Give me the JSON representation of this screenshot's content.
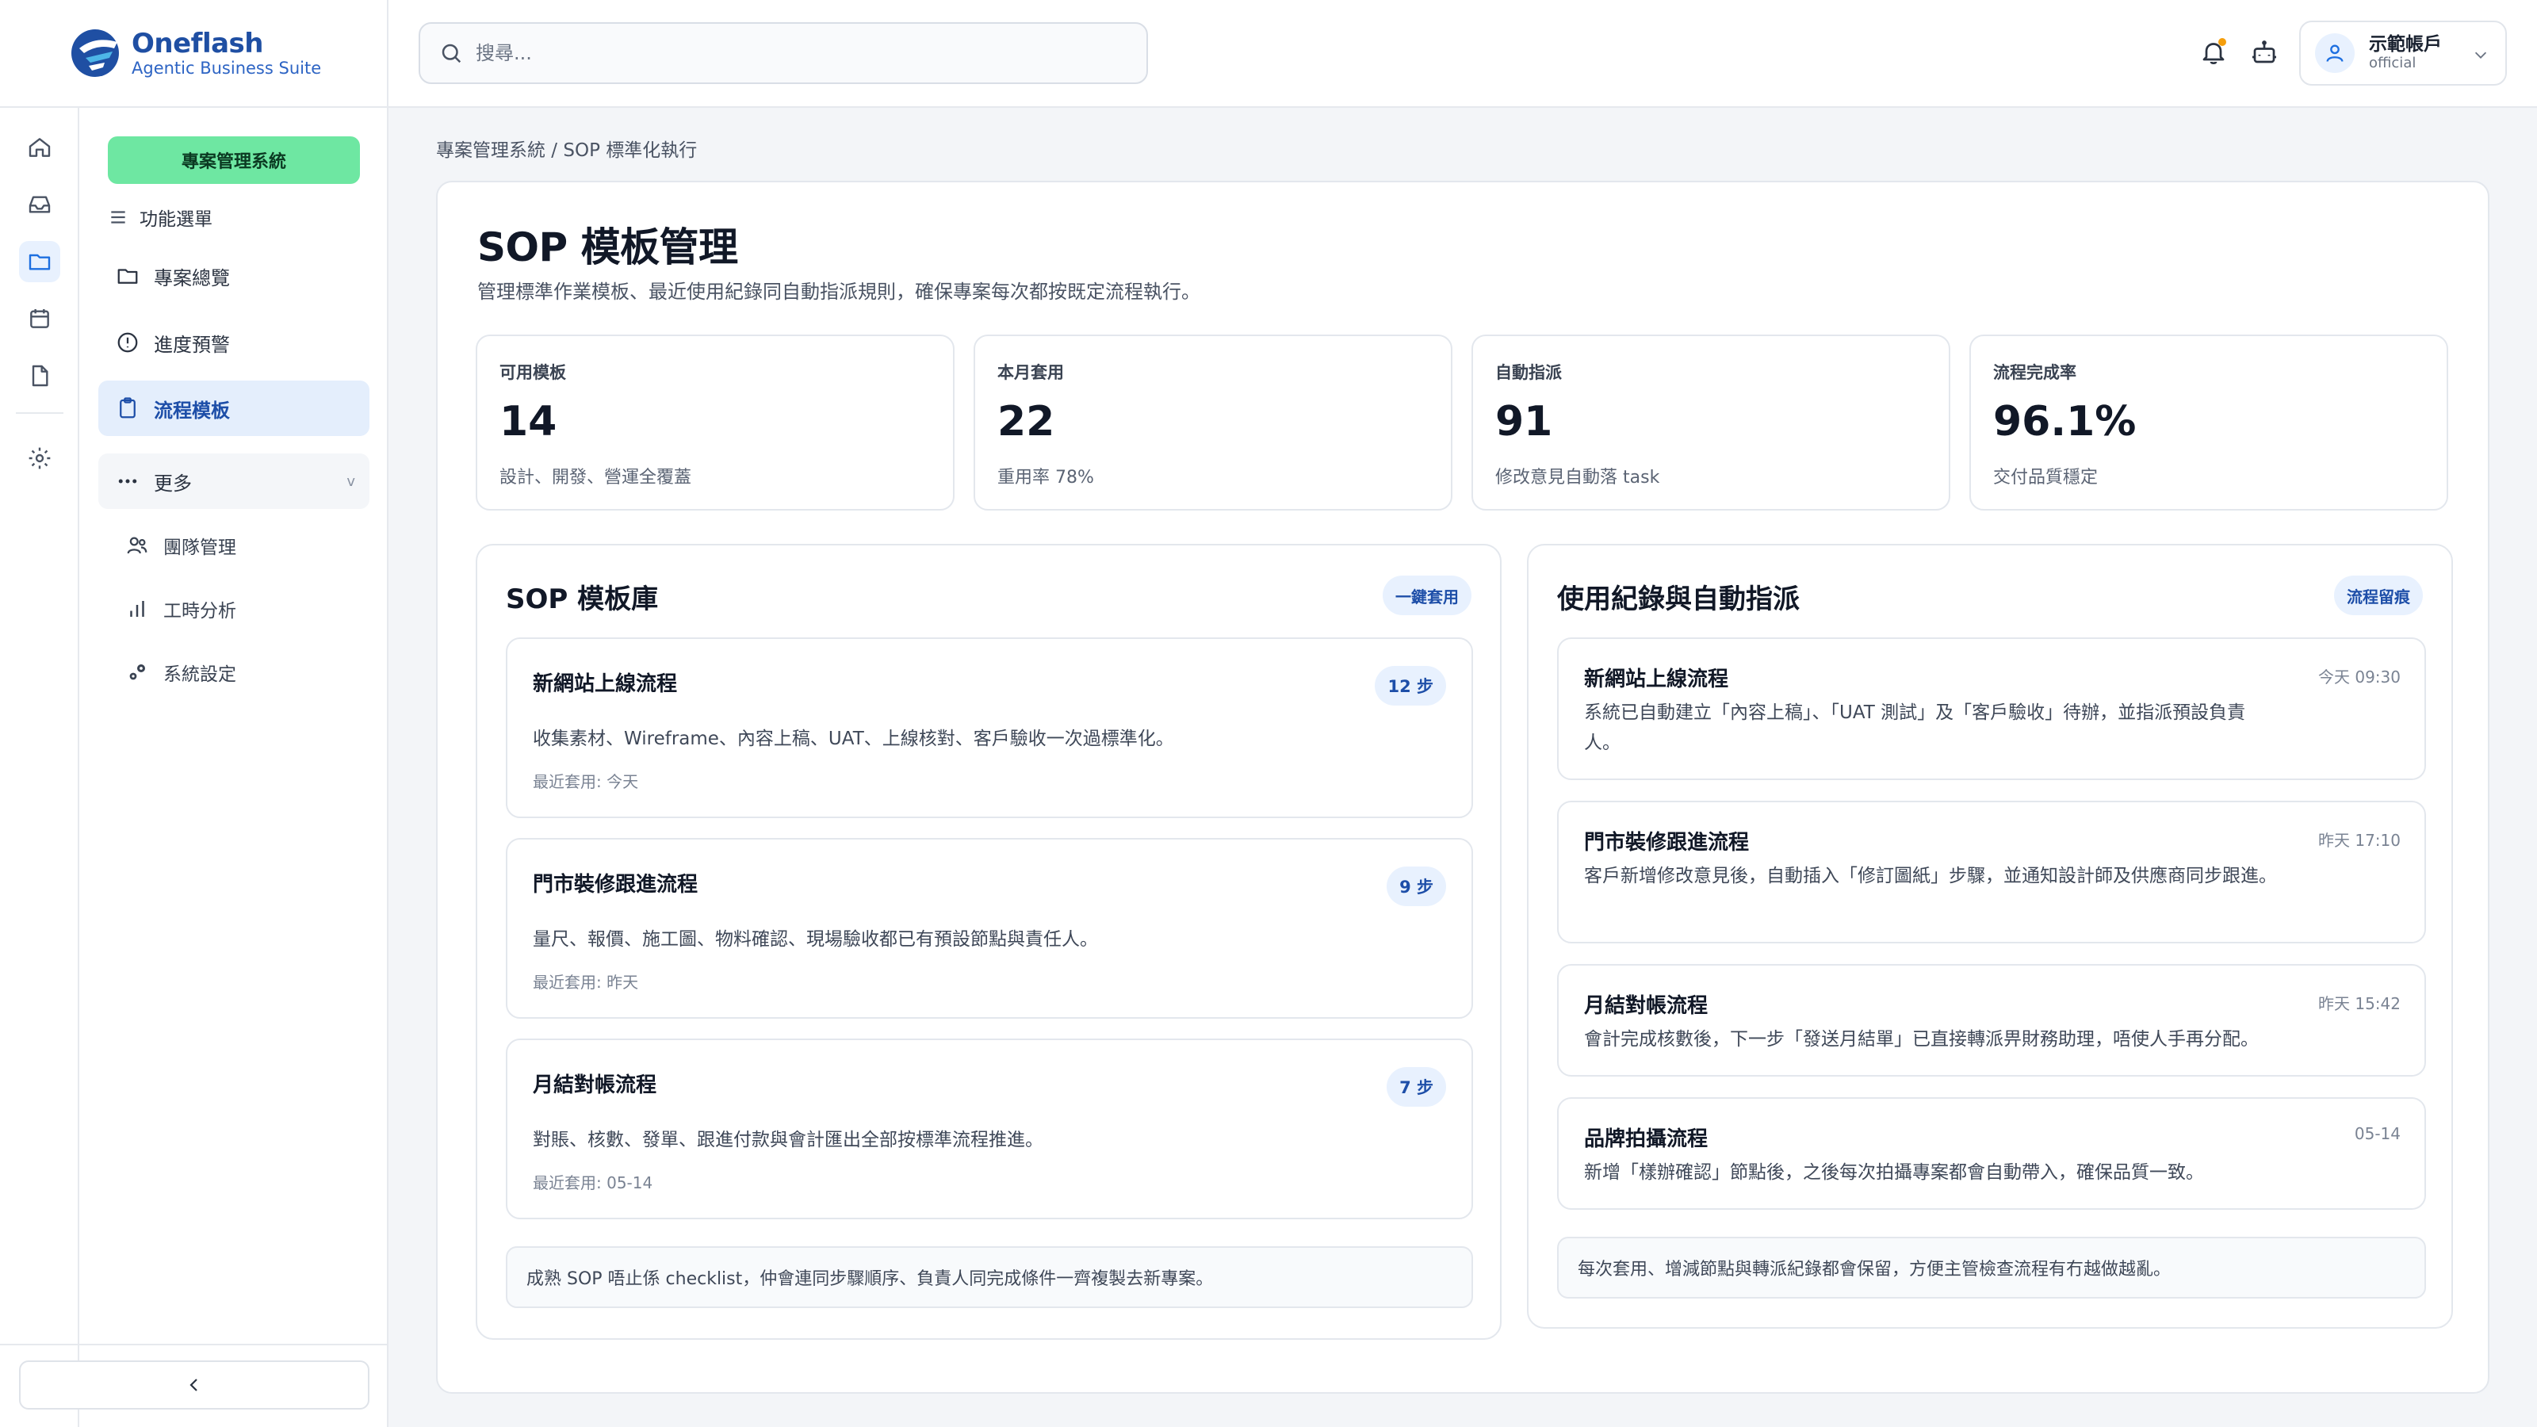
{
  "brand": {
    "name": "Oneflash",
    "tagline": "Agentic Business Suite"
  },
  "sidebar": {
    "module": "專案管理系統",
    "menu_label": "功能選單",
    "items": [
      {
        "label": "專案總覽"
      },
      {
        "label": "進度預警"
      },
      {
        "label": "流程模板"
      },
      {
        "label": "更多"
      }
    ],
    "more_caret": "v",
    "sub_items": [
      {
        "label": "團隊管理"
      },
      {
        "label": "工時分析"
      },
      {
        "label": "系統設定"
      }
    ]
  },
  "topbar": {
    "search_placeholder": "搜尋...",
    "account_name": "示範帳戶",
    "account_role": "official"
  },
  "breadcrumb": "專案管理系統 / SOP 標準化執行",
  "page": {
    "title": "SOP 模板管理",
    "desc": "管理標準作業模板、最近使用紀錄同自動指派規則，確保專案每次都按既定流程執行。"
  },
  "stats": [
    {
      "label": "可用模板",
      "value": "14",
      "note": "設計、開發、營運全覆蓋"
    },
    {
      "label": "本月套用",
      "value": "22",
      "note": "重用率 78%"
    },
    {
      "label": "自動指派",
      "value": "91",
      "note": "修改意見自動落 task"
    },
    {
      "label": "流程完成率",
      "value": "96.1%",
      "note": "交付品質穩定"
    }
  ],
  "library": {
    "title": "SOP 模板庫",
    "badge": "一鍵套用",
    "templates": [
      {
        "name": "新網站上線流程",
        "steps": "12 步",
        "desc": "收集素材、Wireframe、內容上稿、UAT、上線核對、客戶驗收一次過標準化。",
        "recent": "最近套用: 今天"
      },
      {
        "name": "門市裝修跟進流程",
        "steps": "9 步",
        "desc": "量尺、報價、施工圖、物料確認、現場驗收都已有預設節點與責任人。",
        "recent": "最近套用: 昨天"
      },
      {
        "name": "月結對帳流程",
        "steps": "7 步",
        "desc": "對賬、核數、發單、跟進付款與會計匯出全部按標準流程推進。",
        "recent": "最近套用: 05-14"
      }
    ],
    "footer": "成熟 SOP 唔止係 checklist，仲會連同步驟順序、負責人同完成條件一齊複製去新專案。"
  },
  "logs": {
    "title": "使用紀錄與自動指派",
    "badge": "流程留痕",
    "entries": [
      {
        "name": "新網站上線流程",
        "time": "今天 09:30",
        "desc": "系統已自動建立「內容上稿」、「UAT 測試」及「客戶驗收」待辦，並指派預設負責人。"
      },
      {
        "name": "門市裝修跟進流程",
        "time": "昨天 17:10",
        "desc": "客戶新增修改意見後，自動插入「修訂圖紙」步驟，並通知設計師及供應商同步跟進。"
      },
      {
        "name": "月結對帳流程",
        "time": "昨天 15:42",
        "desc": "會計完成核數後，下一步「發送月結單」已直接轉派畀財務助理，唔使人手再分配。"
      },
      {
        "name": "品牌拍攝流程",
        "time": "05-14",
        "desc": "新增「樣辦確認」節點後，之後每次拍攝專案都會自動帶入，確保品質一致。"
      }
    ],
    "footer": "每次套用、增減節點與轉派紀錄都會保留，方便主管檢查流程有冇越做越亂。"
  },
  "colors": {
    "accent": "#1d4ea8",
    "module_green": "#6ee7a2",
    "badge_bg": "#e8f1fe",
    "alert_dot": "#f59e0b"
  }
}
